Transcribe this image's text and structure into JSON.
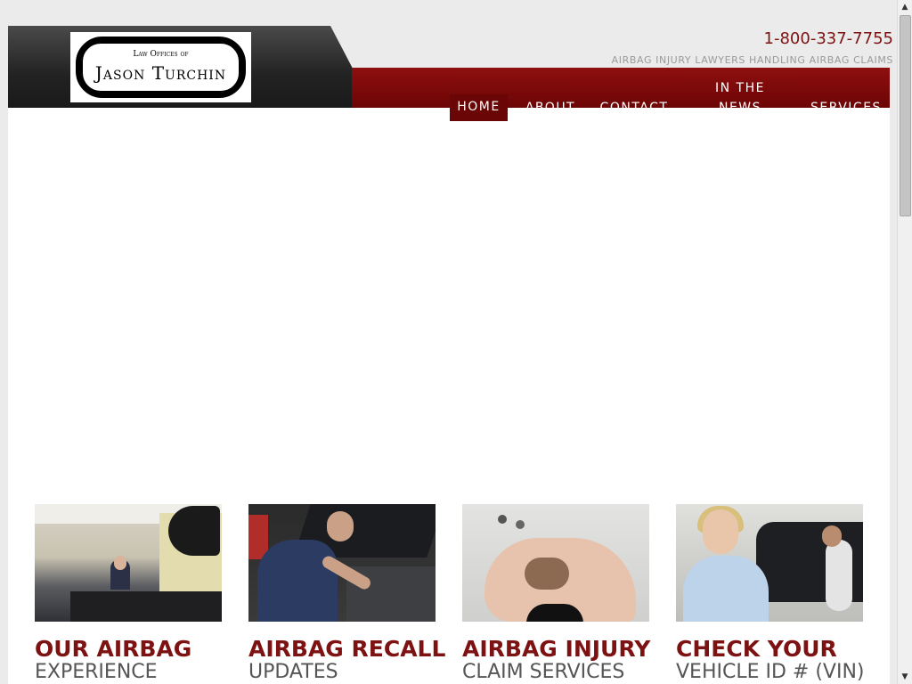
{
  "header": {
    "logo": {
      "top_text": "Law Offices of",
      "name": "Jason Turchin"
    },
    "phone": "1-800-337-7755",
    "tagline": "AIRBAG INJURY LAWYERS HANDLING AIRBAG CLAIMS"
  },
  "nav": {
    "home": "HOME",
    "about": "ABOUT",
    "contact": "CONTACT",
    "news_line1": "IN THE",
    "news_line2": "NEWS",
    "services": "SERVICES"
  },
  "cards": [
    {
      "title": "OUR AIRBAG",
      "subtitle": "EXPERIENCE"
    },
    {
      "title": "AIRBAG RECALL",
      "subtitle": "UPDATES"
    },
    {
      "title": "AIRBAG INJURY",
      "subtitle": "CLAIM SERVICES"
    },
    {
      "title": "CHECK YOUR",
      "subtitle": "VEHICLE ID # (VIN)"
    }
  ],
  "colors": {
    "brand_red": "#7d1212",
    "nav_red": "#8e0f0f",
    "dark": "#222222"
  },
  "icons": {
    "scroll_up": "▲",
    "scroll_down": "▼"
  }
}
